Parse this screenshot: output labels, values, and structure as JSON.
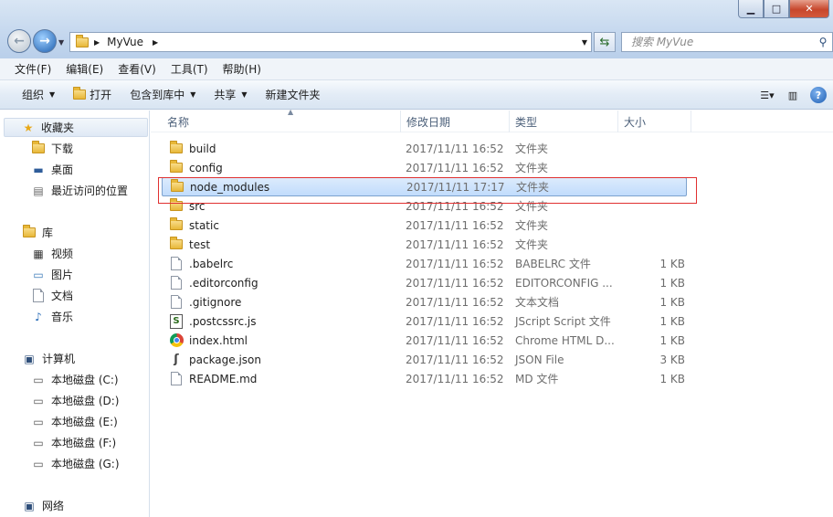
{
  "address": {
    "crumb": "MyVue",
    "search_placeholder": "搜索 MyVue"
  },
  "menu": [
    "文件(F)",
    "编辑(E)",
    "查看(V)",
    "工具(T)",
    "帮助(H)"
  ],
  "toolbar": {
    "organize": "组织",
    "open": "打开",
    "include": "包含到库中",
    "share": "共享",
    "new_folder": "新建文件夹"
  },
  "nav": {
    "favorites": "收藏夹",
    "downloads": "下载",
    "desktop": "桌面",
    "recent": "最近访问的位置",
    "libraries": "库",
    "videos": "视频",
    "pictures": "图片",
    "documents": "文档",
    "music": "音乐",
    "computer": "计算机",
    "drive_c": "本地磁盘 (C:)",
    "drive_d": "本地磁盘 (D:)",
    "drive_e": "本地磁盘 (E:)",
    "drive_f": "本地磁盘 (F:)",
    "drive_g": "本地磁盘 (G:)",
    "network": "网络"
  },
  "columns": {
    "name": "名称",
    "date": "修改日期",
    "type": "类型",
    "size": "大小"
  },
  "files": [
    {
      "name": "build",
      "date": "2017/11/11 16:52",
      "type": "文件夹",
      "size": "",
      "icon": "folder-icon"
    },
    {
      "name": "config",
      "date": "2017/11/11 16:52",
      "type": "文件夹",
      "size": "",
      "icon": "folder-icon"
    },
    {
      "name": "node_modules",
      "date": "2017/11/11 17:17",
      "type": "文件夹",
      "size": "",
      "icon": "folder-icon",
      "selected": true
    },
    {
      "name": "src",
      "date": "2017/11/11 16:52",
      "type": "文件夹",
      "size": "",
      "icon": "folder-icon"
    },
    {
      "name": "static",
      "date": "2017/11/11 16:52",
      "type": "文件夹",
      "size": "",
      "icon": "folder-icon"
    },
    {
      "name": "test",
      "date": "2017/11/11 16:52",
      "type": "文件夹",
      "size": "",
      "icon": "folder-icon"
    },
    {
      "name": ".babelrc",
      "date": "2017/11/11 16:52",
      "type": "BABELRC 文件",
      "size": "1 KB",
      "icon": "file-icon"
    },
    {
      "name": ".editorconfig",
      "date": "2017/11/11 16:52",
      "type": "EDITORCONFIG ...",
      "size": "1 KB",
      "icon": "file-icon"
    },
    {
      "name": ".gitignore",
      "date": "2017/11/11 16:52",
      "type": "文本文档",
      "size": "1 KB",
      "icon": "file-icon"
    },
    {
      "name": ".postcssrc.js",
      "date": "2017/11/11 16:52",
      "type": "JScript Script 文件",
      "size": "1 KB",
      "icon": "jscript-icon"
    },
    {
      "name": "index.html",
      "date": "2017/11/11 16:52",
      "type": "Chrome HTML D...",
      "size": "1 KB",
      "icon": "chrome-icon"
    },
    {
      "name": "package.json",
      "date": "2017/11/11 16:52",
      "type": "JSON File",
      "size": "3 KB",
      "icon": "json-icon"
    },
    {
      "name": "README.md",
      "date": "2017/11/11 16:52",
      "type": "MD 文件",
      "size": "1 KB",
      "icon": "file-icon"
    }
  ]
}
